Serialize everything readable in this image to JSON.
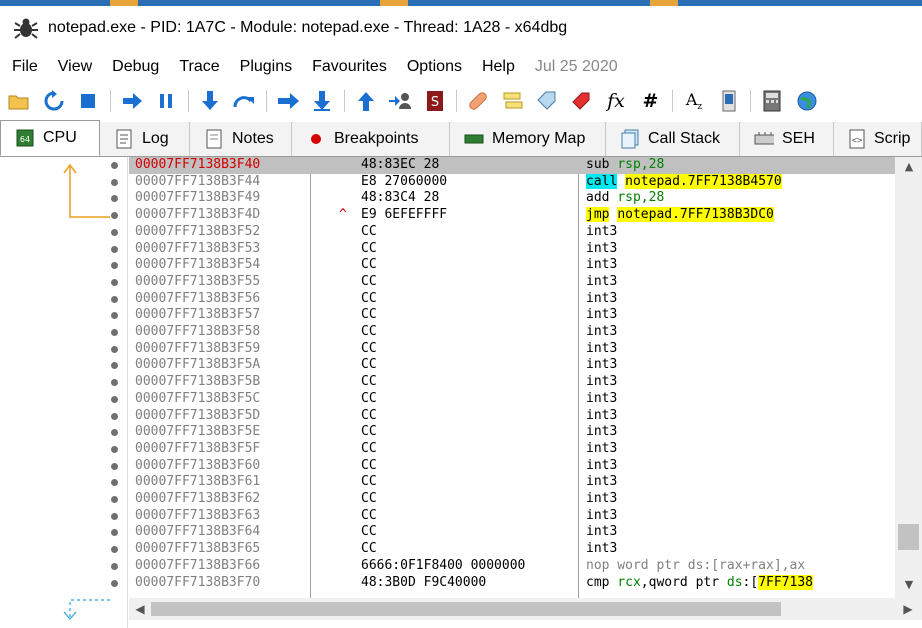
{
  "window": {
    "title": "notepad.exe - PID: 1A7C - Module: notepad.exe - Thread: 1A28 - x64dbg",
    "app_icon": "bug-icon"
  },
  "menu": {
    "items": [
      "File",
      "View",
      "Debug",
      "Trace",
      "Plugins",
      "Favourites",
      "Options",
      "Help"
    ],
    "date": "Jul 25 2020"
  },
  "toolbar": {
    "icons": [
      "open-folder-icon",
      "restart-icon",
      "stop-icon",
      "run-icon",
      "pause-icon",
      "step-into-icon",
      "step-over-icon",
      "trace-into-icon",
      "trace-over-icon",
      "execute-till-return-icon",
      "run-to-user-code-icon",
      "scylla-icon",
      "patch-icon",
      "comments-icon",
      "labels-icon",
      "bookmarks-icon",
      "functions-icon",
      "variables-icon",
      "font-icon",
      "memory-icon",
      "calculator-icon",
      "globe-icon"
    ]
  },
  "tabs": [
    {
      "label": "CPU",
      "icon": "cpu-icon",
      "active": true
    },
    {
      "label": "Log",
      "icon": "log-icon"
    },
    {
      "label": "Notes",
      "icon": "notes-icon"
    },
    {
      "label": "Breakpoints",
      "icon": "breakpoint-icon"
    },
    {
      "label": "Memory Map",
      "icon": "memory-map-icon"
    },
    {
      "label": "Call Stack",
      "icon": "call-stack-icon"
    },
    {
      "label": "SEH",
      "icon": "seh-icon"
    },
    {
      "label": "Scrip",
      "icon": "script-icon"
    }
  ],
  "disassembly": {
    "rows": [
      {
        "addr": "00007FF7138B3F40",
        "bytes": "48:83EC 28",
        "mnemonic": "sub",
        "operand": "rsp,28",
        "kind": "arith",
        "selected": true
      },
      {
        "addr": "00007FF7138B3F44",
        "bytes": "E8 27060000",
        "mnemonic": "call",
        "operand": "notepad.7FF7138B4570",
        "kind": "call"
      },
      {
        "addr": "00007FF7138B3F49",
        "bytes": "48:83C4 28",
        "mnemonic": "add",
        "operand": "rsp,28",
        "kind": "arith"
      },
      {
        "addr": "00007FF7138B3F4D",
        "bytes": "E9 6EFEFFFF",
        "mnemonic": "jmp",
        "operand": "notepad.7FF7138B3DC0",
        "kind": "jmp",
        "mark": "^"
      },
      {
        "addr": "00007FF7138B3F52",
        "bytes": "CC",
        "mnemonic": "int3",
        "kind": "int3"
      },
      {
        "addr": "00007FF7138B3F53",
        "bytes": "CC",
        "mnemonic": "int3",
        "kind": "int3"
      },
      {
        "addr": "00007FF7138B3F54",
        "bytes": "CC",
        "mnemonic": "int3",
        "kind": "int3"
      },
      {
        "addr": "00007FF7138B3F55",
        "bytes": "CC",
        "mnemonic": "int3",
        "kind": "int3"
      },
      {
        "addr": "00007FF7138B3F56",
        "bytes": "CC",
        "mnemonic": "int3",
        "kind": "int3"
      },
      {
        "addr": "00007FF7138B3F57",
        "bytes": "CC",
        "mnemonic": "int3",
        "kind": "int3"
      },
      {
        "addr": "00007FF7138B3F58",
        "bytes": "CC",
        "mnemonic": "int3",
        "kind": "int3"
      },
      {
        "addr": "00007FF7138B3F59",
        "bytes": "CC",
        "mnemonic": "int3",
        "kind": "int3"
      },
      {
        "addr": "00007FF7138B3F5A",
        "bytes": "CC",
        "mnemonic": "int3",
        "kind": "int3"
      },
      {
        "addr": "00007FF7138B3F5B",
        "bytes": "CC",
        "mnemonic": "int3",
        "kind": "int3"
      },
      {
        "addr": "00007FF7138B3F5C",
        "bytes": "CC",
        "mnemonic": "int3",
        "kind": "int3"
      },
      {
        "addr": "00007FF7138B3F5D",
        "bytes": "CC",
        "mnemonic": "int3",
        "kind": "int3"
      },
      {
        "addr": "00007FF7138B3F5E",
        "bytes": "CC",
        "mnemonic": "int3",
        "kind": "int3"
      },
      {
        "addr": "00007FF7138B3F5F",
        "bytes": "CC",
        "mnemonic": "int3",
        "kind": "int3"
      },
      {
        "addr": "00007FF7138B3F60",
        "bytes": "CC",
        "mnemonic": "int3",
        "kind": "int3"
      },
      {
        "addr": "00007FF7138B3F61",
        "bytes": "CC",
        "mnemonic": "int3",
        "kind": "int3"
      },
      {
        "addr": "00007FF7138B3F62",
        "bytes": "CC",
        "mnemonic": "int3",
        "kind": "int3"
      },
      {
        "addr": "00007FF7138B3F63",
        "bytes": "CC",
        "mnemonic": "int3",
        "kind": "int3"
      },
      {
        "addr": "00007FF7138B3F64",
        "bytes": "CC",
        "mnemonic": "int3",
        "kind": "int3"
      },
      {
        "addr": "00007FF7138B3F65",
        "bytes": "CC",
        "mnemonic": "int3",
        "kind": "int3"
      },
      {
        "addr": "00007FF7138B3F66",
        "bytes": "6666:0F1F8400 0000000",
        "mnemonic": "nop word ptr ds:[rax+rax],ax",
        "kind": "nop"
      },
      {
        "addr": "00007FF7138B3F70",
        "bytes": "48:3B0D F9C40000",
        "mnemonic": "cmp",
        "operand": "rcx,qword ptr ds:[7FF7138",
        "kind": "cmp"
      }
    ]
  },
  "colors": {
    "selected_row": "#c0c0c0",
    "selected_addr": "#d30000",
    "call_highlight": "#00e8f0",
    "jmp_highlight": "#ffff00",
    "register": "#008000"
  }
}
